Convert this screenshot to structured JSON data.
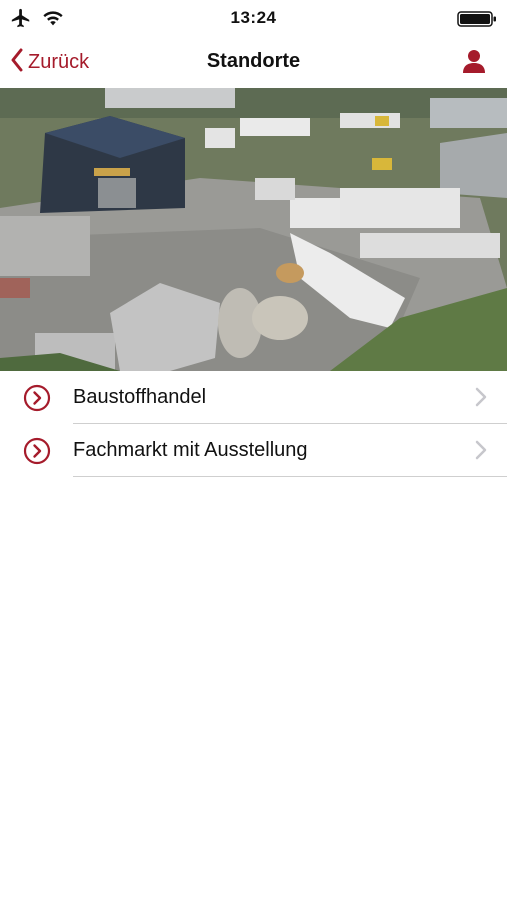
{
  "status_bar": {
    "time": "13:24",
    "icons": [
      "airplane-icon",
      "wifi-icon",
      "battery-icon"
    ]
  },
  "nav": {
    "back_label": "Zurück",
    "title": "Standorte",
    "icons": [
      "chevron-left-icon",
      "person-icon"
    ]
  },
  "hero": {
    "description_icon": "photo"
  },
  "list": {
    "items": [
      {
        "label": "Baustoffhandel"
      },
      {
        "label": "Fachmarkt mit Ausstellung"
      }
    ]
  },
  "colors": {
    "accent": "#a51b2b",
    "separator": "#cfcfcf",
    "chevron": "#c7c7cc"
  }
}
